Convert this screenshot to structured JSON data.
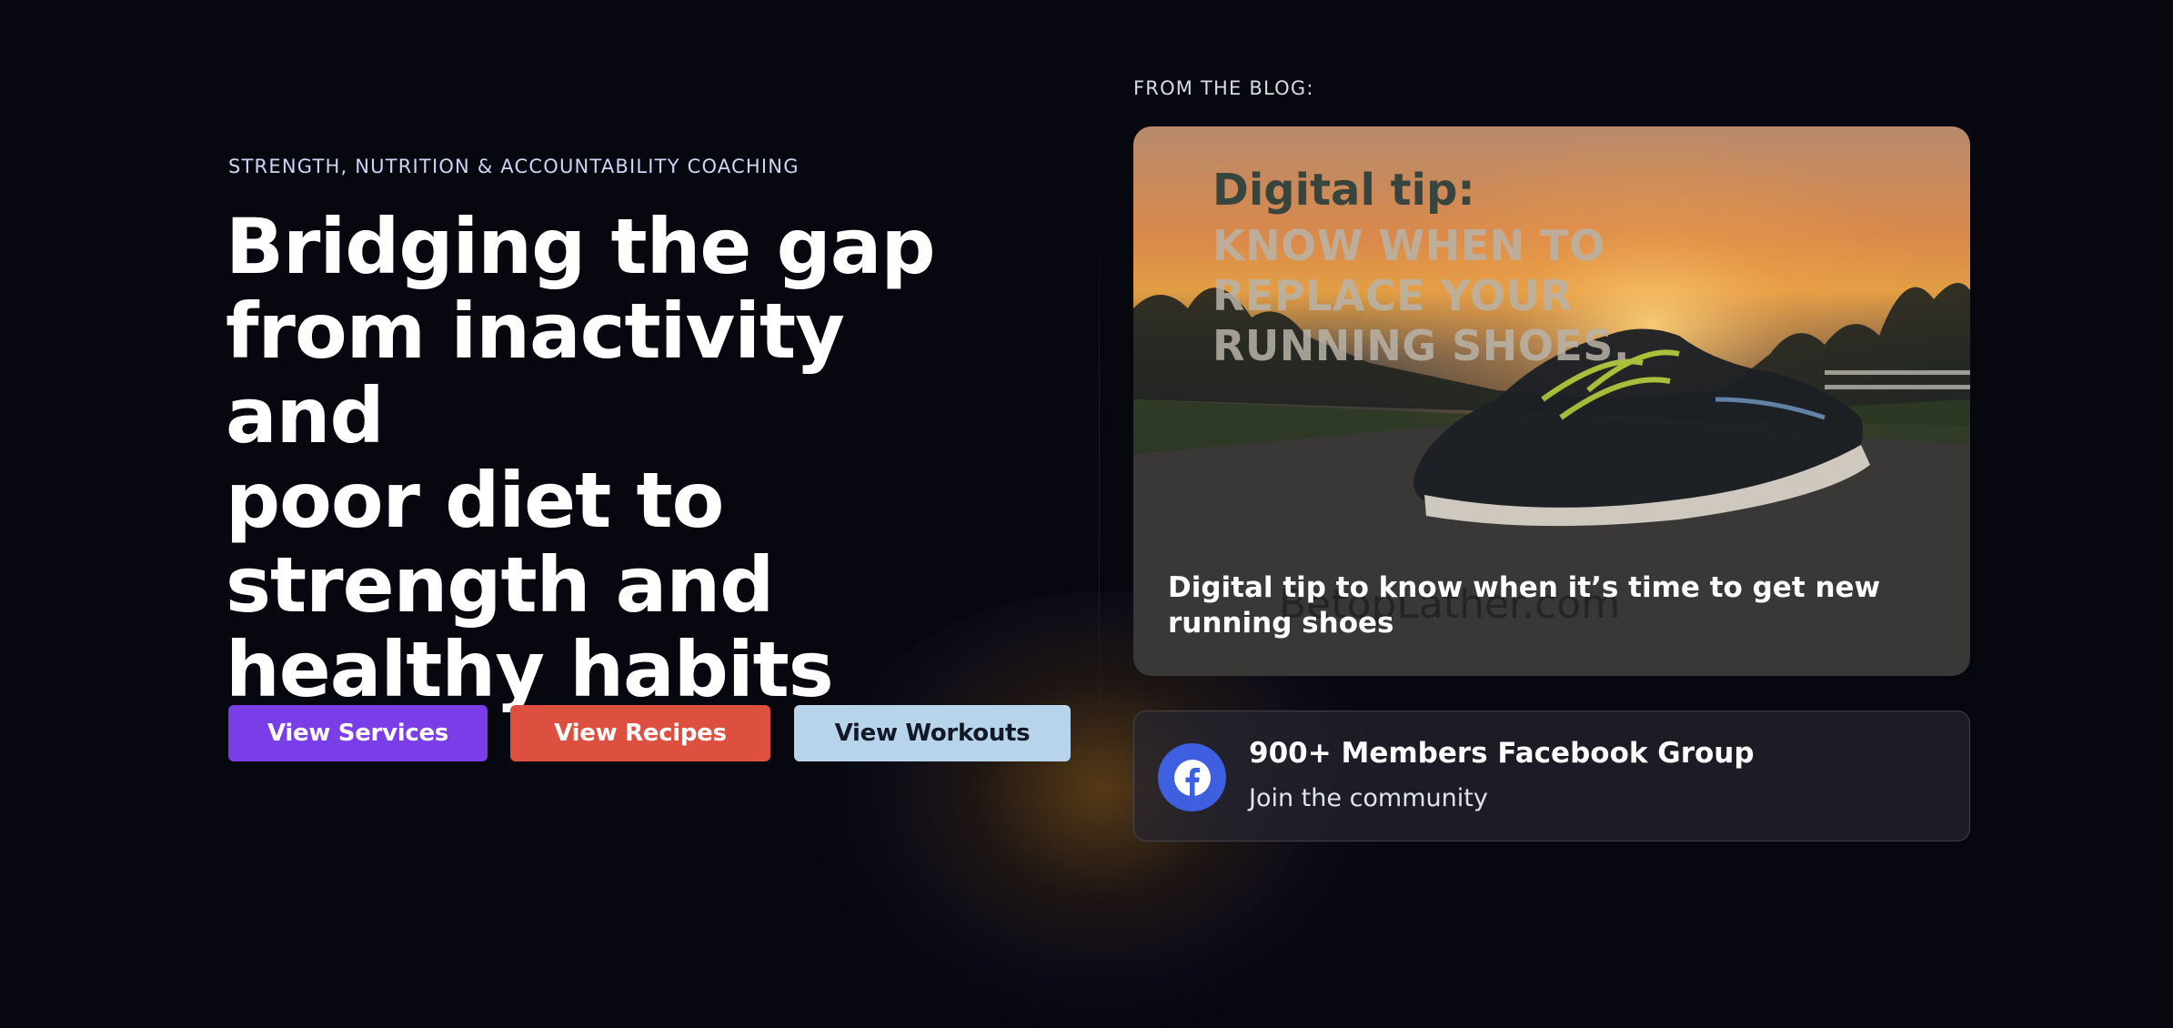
{
  "hero": {
    "eyebrow": "STRENGTH, NUTRITION & ACCOUNTABILITY COACHING",
    "headline_lines": [
      "Bridging the gap",
      "from inactivity and",
      "poor diet to",
      "strength and",
      "healthy habits"
    ],
    "buttons": [
      {
        "label": "View Services",
        "color": "#7a3ee8"
      },
      {
        "label": "View Recipes",
        "color": "#dd5040"
      },
      {
        "label": "View Workouts",
        "color": "#b8d4ea"
      }
    ]
  },
  "blog": {
    "label": "FROM THE BLOG:",
    "card": {
      "image_title": "Digital tip:",
      "image_lines": [
        "KNOW WHEN TO",
        "REPLACE YOUR",
        "RUNNING SHOES."
      ],
      "watermark": "BetopLather.com",
      "caption": "Digital tip to know when it’s time to get new running shoes"
    }
  },
  "community": {
    "icon": "facebook-icon",
    "title": "900+ Members Facebook Group",
    "subtitle": "Join the community",
    "color": "#3d5fe0"
  },
  "theme": {
    "background": "#07070f"
  }
}
